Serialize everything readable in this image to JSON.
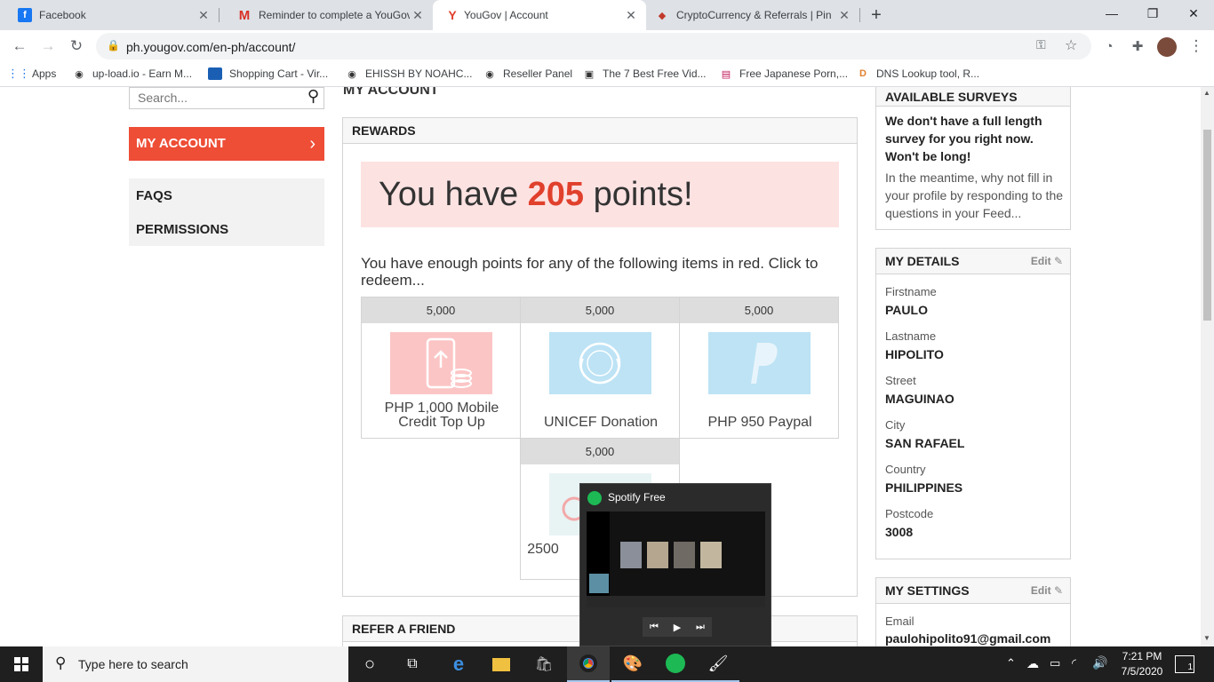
{
  "tabs": [
    {
      "label": "Facebook",
      "favicon": "facebook-icon",
      "color": "#1877f2",
      "glyph": "f"
    },
    {
      "label": "Reminder to complete a YouGov",
      "favicon": "gmail-icon",
      "color": "#ffffff",
      "glyph": "M"
    },
    {
      "label": "YouGov | Account",
      "favicon": "yougov-icon",
      "color": "#ffffff",
      "glyph": "Y"
    },
    {
      "label": "CryptoCurrency & Referrals | Pin",
      "favicon": "crypto-icon",
      "color": "#ffffff",
      "glyph": "◆"
    }
  ],
  "address": {
    "url": "ph.yougov.com/en-ph/account/"
  },
  "bookmarks": [
    {
      "label": "Apps"
    },
    {
      "label": "up-load.io - Earn M..."
    },
    {
      "label": "Shopping Cart - Vir..."
    },
    {
      "label": "EHISSH BY NOAHC..."
    },
    {
      "label": "Reseller Panel"
    },
    {
      "label": "The 7 Best Free Vid..."
    },
    {
      "label": "Free Japanese Porn,..."
    },
    {
      "label": "DNS Lookup tool, R..."
    }
  ],
  "sidebar": {
    "search_placeholder": "Search...",
    "my_account": "MY ACCOUNT",
    "faqs": "FAQS",
    "permissions": "PERMISSIONS"
  },
  "main": {
    "page_title": "MY ACCOUNT",
    "rewards_header": "REWARDS",
    "points_prefix": "You have ",
    "points_value": "205",
    "points_suffix": " points!",
    "enough_text": "You have enough points for any of the following items in red. Click to redeem...",
    "rewards": [
      {
        "cost": "5,000",
        "name": "PHP 1,000 Mobile Credit Top Up",
        "color": "#fcc5c5"
      },
      {
        "cost": "5,000",
        "name": "UNICEF Donation",
        "color": "#bde3f5"
      },
      {
        "cost": "5,000",
        "name": "PHP 950 Paypal",
        "color": "#bde3f5"
      },
      {
        "cost": "5,000",
        "name": "2500",
        "color": "#e8f3f4"
      }
    ],
    "refer_header": "REFER A FRIEND"
  },
  "right": {
    "surveys_header": "AVAILABLE SURVEYS",
    "surveys_bold": "We don't have a full length survey for you right now. Won't be long!",
    "surveys_text": "In the meantime, why not fill in your profile by responding to the questions in your Feed...",
    "details_header": "MY DETAILS",
    "edit_label": "Edit",
    "details": [
      {
        "label": "Firstname",
        "value": "PAULO"
      },
      {
        "label": "Lastname",
        "value": "HIPOLITO"
      },
      {
        "label": "Street",
        "value": "MAGUINAO"
      },
      {
        "label": "City",
        "value": "SAN RAFAEL"
      },
      {
        "label": "Country",
        "value": "PHILIPPINES"
      },
      {
        "label": "Postcode",
        "value": "3008"
      }
    ],
    "settings_header": "MY SETTINGS",
    "email_label": "Email",
    "email_value": "paulohipolito91@gmail.com"
  },
  "spotify": {
    "title": "Spotify Free"
  },
  "taskbar": {
    "search_placeholder": "Type here to search",
    "time": "7:21 PM",
    "date": "7/5/2020",
    "notifications": "1"
  }
}
